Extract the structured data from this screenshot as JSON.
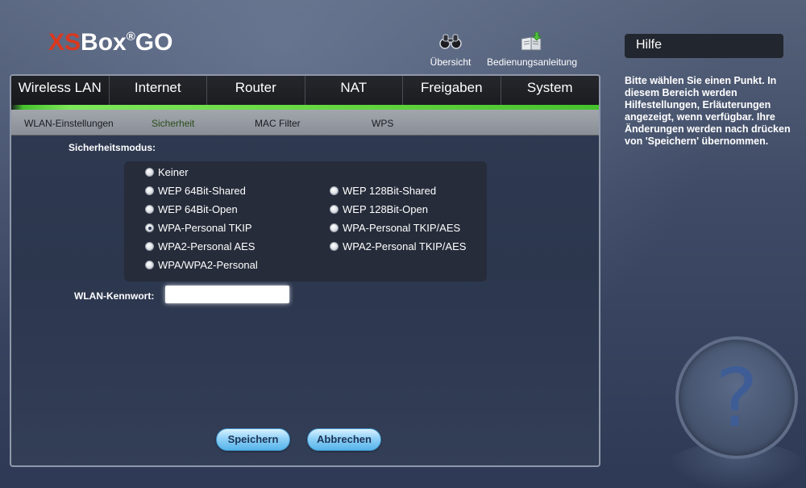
{
  "logo": {
    "xs": "XS",
    "box": "Box",
    "reg": "®",
    "go": "GO"
  },
  "toplinks": {
    "overview": "Übersicht",
    "manual": "Bedienungsanleitung"
  },
  "tabs": [
    {
      "label": "Wireless LAN",
      "active": true
    },
    {
      "label": "Internet"
    },
    {
      "label": "Router"
    },
    {
      "label": "NAT"
    },
    {
      "label": "Freigaben"
    },
    {
      "label": "System"
    }
  ],
  "subnav": [
    {
      "label": "WLAN-Einstellungen"
    },
    {
      "label": "Sicherheit",
      "active": true
    },
    {
      "label": "MAC Filter"
    },
    {
      "label": "WPS"
    }
  ],
  "security": {
    "label": "Sicherheitsmodus:",
    "options": [
      {
        "label": "Keiner",
        "checked": false
      },
      {
        "label": "WEP 64Bit-Shared",
        "checked": false
      },
      {
        "label": "WEP 64Bit-Open",
        "checked": false
      },
      {
        "label": "WPA-Personal TKIP",
        "checked": true
      },
      {
        "label": "WPA2-Personal AES",
        "checked": false
      },
      {
        "label": "WPA/WPA2-Personal",
        "checked": false
      },
      {
        "label": "WEP 128Bit-Shared",
        "checked": false
      },
      {
        "label": "WEP 128Bit-Open",
        "checked": false
      },
      {
        "label": "WPA-Personal TKIP/AES",
        "checked": false
      },
      {
        "label": "WPA2-Personal TKIP/AES",
        "checked": false
      }
    ]
  },
  "password": {
    "label": "WLAN-Kennwort:",
    "value": ""
  },
  "buttons": {
    "save": "Speichern",
    "cancel": "Abbrechen"
  },
  "help": {
    "title": "Hilfe",
    "text": "Bitte wählen Sie einen Punkt. In diesem Bereich werden Hilfestellungen, Erläuterungen angezeigt, wenn verfügbar. Ihre Änderungen werden nach drücken von 'Speichern' übernommen.",
    "icon": "question-icon",
    "icon_glyph": "?"
  },
  "colors": {
    "accent_green": "#62d43e",
    "logo_red": "#d9381e",
    "button_blue": "#8fd1f7"
  }
}
